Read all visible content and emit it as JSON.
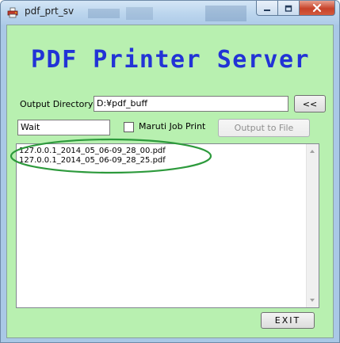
{
  "window": {
    "title": "pdf_prt_sv"
  },
  "header": {
    "title": "PDF Printer Server"
  },
  "output_directory": {
    "label": "Output Directory",
    "value": "D:¥pdf_buff",
    "browse_label": "<<"
  },
  "status": {
    "value": "Wait"
  },
  "maruti_job_print": {
    "label": "Maruti Job Print",
    "checked": false
  },
  "output_to_file": {
    "label": "Output to File",
    "enabled": false
  },
  "file_list": {
    "items": [
      "127.0.0.1_2014_05_06-09_28_00.pdf",
      "127.0.0.1_2014_05_06-09_28_25.pdf"
    ]
  },
  "exit_button": {
    "label": "EXIT"
  },
  "colors": {
    "client_background": "#b8f0b0",
    "title_text": "#2233d6",
    "annotation_ellipse": "#2d9a3c"
  },
  "icons": {
    "app": "printer-icon",
    "minimize": "minimize-icon",
    "maximize": "maximize-icon",
    "close": "close-icon"
  }
}
